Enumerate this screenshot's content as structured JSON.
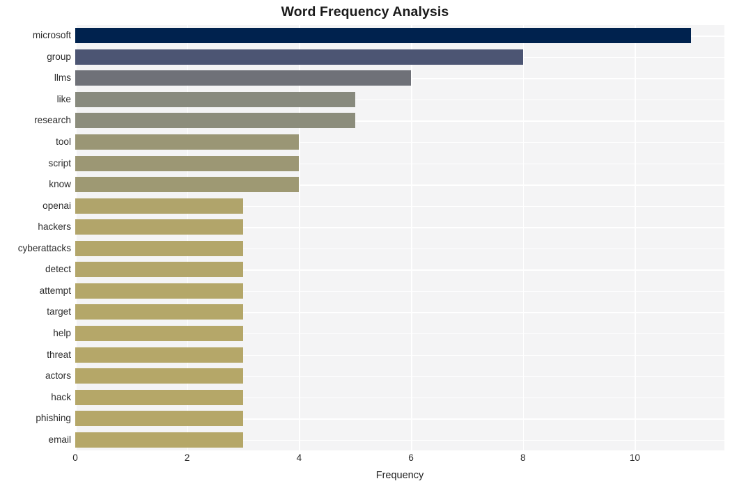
{
  "chart_data": {
    "type": "bar",
    "orientation": "horizontal",
    "title": "Word Frequency Analysis",
    "xlabel": "Frequency",
    "ylabel": "",
    "categories": [
      "microsoft",
      "group",
      "llms",
      "like",
      "research",
      "tool",
      "script",
      "know",
      "openai",
      "hackers",
      "cyberattacks",
      "detect",
      "attempt",
      "target",
      "help",
      "threat",
      "actors",
      "hack",
      "phishing",
      "email"
    ],
    "values": [
      11,
      8,
      6,
      5,
      5,
      4,
      4,
      4,
      3,
      3,
      3,
      3,
      3,
      3,
      3,
      3,
      3,
      3,
      3,
      3
    ],
    "bar_colors": [
      "#00224e",
      "#4c5573",
      "#6f7178",
      "#888a7e",
      "#8c8d7c",
      "#9a9675",
      "#9c9774",
      "#9e9973",
      "#b0a46b",
      "#b2a56a",
      "#b3a66a",
      "#b3a66a",
      "#b4a769",
      "#b4a769",
      "#b5a769",
      "#b5a769",
      "#b5a768",
      "#b5a768",
      "#b5a768",
      "#b5a768"
    ],
    "colormap": "cividis",
    "xlim": [
      0,
      11.6
    ],
    "xticks": [
      0,
      2,
      4,
      6,
      8,
      10
    ],
    "xticklabels": [
      "0",
      "2",
      "4",
      "6",
      "8",
      "10"
    ],
    "grid": true,
    "grid_axis": "both",
    "legend": false,
    "style": "whitegrid",
    "plot_background": "#f4f4f5",
    "figure_background": "#ffffff",
    "gridline_color": "#ffffff"
  }
}
